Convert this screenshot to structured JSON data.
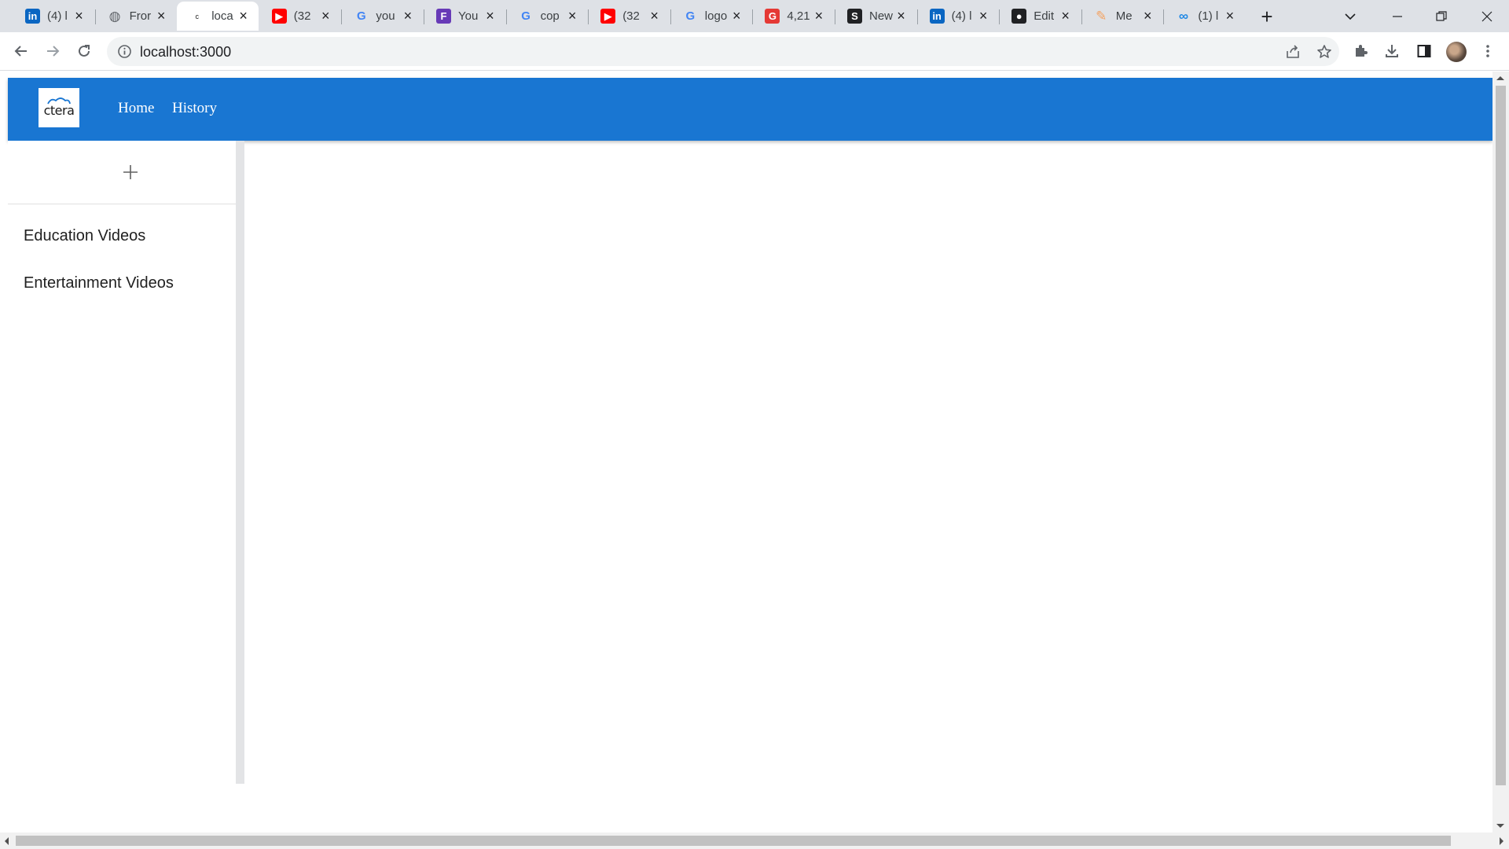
{
  "browser": {
    "tabs": [
      {
        "title": "(4) l",
        "icon": "linkedin-icon",
        "color": "#0a66c2",
        "glyph": "in"
      },
      {
        "title": "Fror",
        "icon": "globe-icon",
        "color": "#5f6368",
        "glyph": "◍"
      },
      {
        "title": "loca",
        "icon": "ctera-icon",
        "color": "#ffffff",
        "glyph": "c"
      },
      {
        "title": "(32",
        "icon": "youtube-icon",
        "color": "#ff0000",
        "glyph": "▶"
      },
      {
        "title": "you",
        "icon": "google-icon",
        "color": "#4285f4",
        "glyph": "G"
      },
      {
        "title": "You",
        "icon": "forms-icon",
        "color": "#673ab7",
        "glyph": "F"
      },
      {
        "title": "cop",
        "icon": "google-icon",
        "color": "#4285f4",
        "glyph": "G"
      },
      {
        "title": "(32",
        "icon": "youtube-icon",
        "color": "#ff0000",
        "glyph": "▶"
      },
      {
        "title": "logo",
        "icon": "google-icon",
        "color": "#4285f4",
        "glyph": "G"
      },
      {
        "title": "4,21",
        "icon": "app-icon",
        "color": "#e53935",
        "glyph": "G"
      },
      {
        "title": "New",
        "icon": "s-icon",
        "color": "#202124",
        "glyph": "S"
      },
      {
        "title": "(4) l",
        "icon": "linkedin-icon",
        "color": "#0a66c2",
        "glyph": "in"
      },
      {
        "title": "Edit",
        "icon": "github-icon",
        "color": "#202124",
        "glyph": "●"
      },
      {
        "title": "Me",
        "icon": "app-icon",
        "color": "#f4a261",
        "glyph": "✎"
      },
      {
        "title": "(1) l",
        "icon": "link-icon",
        "color": "#1e88e5",
        "glyph": "∞"
      }
    ],
    "active_tab": 2,
    "address": "localhost:3000"
  },
  "app": {
    "logo_text": "ctera",
    "nav": {
      "home": "Home",
      "history": "History"
    },
    "add_symbol": "+",
    "categories": [
      "Education Videos",
      "Entertainment Videos"
    ]
  },
  "colors": {
    "header": "#1976d2",
    "tabstrip": "#dee1e6",
    "rail": "#e3e4e6"
  }
}
